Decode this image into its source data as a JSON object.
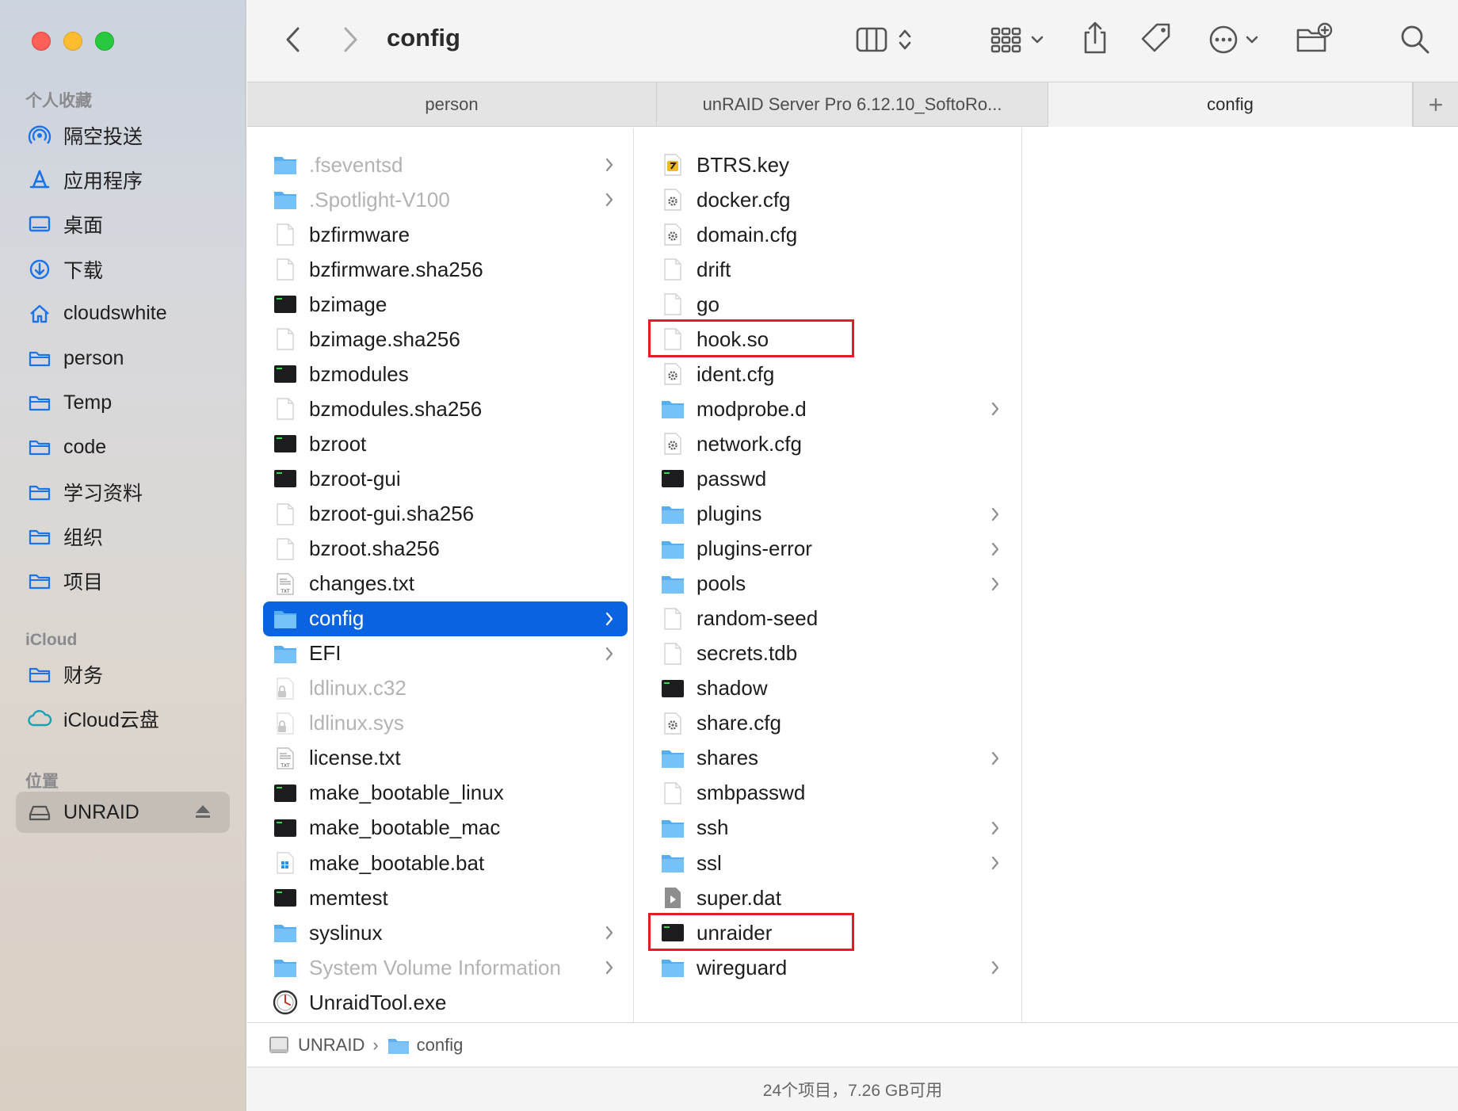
{
  "window": {
    "title": "config"
  },
  "sidebar": {
    "favorites_header": "个人收藏",
    "favorites": [
      {
        "label": "隔空投送",
        "icon": "airdrop-icon"
      },
      {
        "label": "应用程序",
        "icon": "applications-icon"
      },
      {
        "label": "桌面",
        "icon": "desktop-icon"
      },
      {
        "label": "下载",
        "icon": "downloads-icon"
      },
      {
        "label": "cloudswhite",
        "icon": "home-icon"
      },
      {
        "label": "person",
        "icon": "folder-icon"
      },
      {
        "label": "Temp",
        "icon": "folder-icon"
      },
      {
        "label": "code",
        "icon": "folder-icon"
      },
      {
        "label": "学习资料",
        "icon": "folder-icon"
      },
      {
        "label": "组织",
        "icon": "folder-icon"
      },
      {
        "label": "项目",
        "icon": "folder-icon"
      }
    ],
    "icloud_header": "iCloud",
    "icloud": [
      {
        "label": "财务",
        "icon": "folder-icon"
      },
      {
        "label": "iCloud云盘",
        "icon": "icloud-icon"
      }
    ],
    "locations_header": "位置",
    "locations": [
      {
        "label": "UNRAID",
        "icon": "drive-icon",
        "selected": true
      }
    ]
  },
  "tabs": [
    {
      "label": "person",
      "active": false
    },
    {
      "label": "unRAID Server Pro 6.12.10_SoftoRo...",
      "active": false
    },
    {
      "label": "config",
      "active": true
    }
  ],
  "column1": [
    {
      "name": ".fseventsd",
      "type": "folder",
      "dim": true,
      "chevron": true
    },
    {
      "name": ".Spotlight-V100",
      "type": "folder",
      "dim": true,
      "chevron": true
    },
    {
      "name": "bzfirmware",
      "type": "file"
    },
    {
      "name": "bzfirmware.sha256",
      "type": "file"
    },
    {
      "name": "bzimage",
      "type": "exec"
    },
    {
      "name": "bzimage.sha256",
      "type": "file"
    },
    {
      "name": "bzmodules",
      "type": "exec"
    },
    {
      "name": "bzmodules.sha256",
      "type": "file"
    },
    {
      "name": "bzroot",
      "type": "exec"
    },
    {
      "name": "bzroot-gui",
      "type": "exec"
    },
    {
      "name": "bzroot-gui.sha256",
      "type": "file"
    },
    {
      "name": "bzroot.sha256",
      "type": "file"
    },
    {
      "name": "changes.txt",
      "type": "txt"
    },
    {
      "name": "config",
      "type": "folder",
      "selected": true,
      "chevron": true
    },
    {
      "name": "EFI",
      "type": "folder",
      "chevron": true
    },
    {
      "name": "ldlinux.c32",
      "type": "locked",
      "dim": true
    },
    {
      "name": "ldlinux.sys",
      "type": "locked",
      "dim": true
    },
    {
      "name": "license.txt",
      "type": "txt"
    },
    {
      "name": "make_bootable_linux",
      "type": "exec"
    },
    {
      "name": "make_bootable_mac",
      "type": "exec"
    },
    {
      "name": "make_bootable.bat",
      "type": "bat"
    },
    {
      "name": "memtest",
      "type": "exec"
    },
    {
      "name": "syslinux",
      "type": "folder",
      "chevron": true
    },
    {
      "name": "System Volume Information",
      "type": "folder",
      "dim": true,
      "chevron": true
    },
    {
      "name": "UnraidTool.exe",
      "type": "exe"
    }
  ],
  "column2": [
    {
      "name": "BTRS.key",
      "type": "key"
    },
    {
      "name": "docker.cfg",
      "type": "cfg"
    },
    {
      "name": "domain.cfg",
      "type": "cfg"
    },
    {
      "name": "drift",
      "type": "file"
    },
    {
      "name": "go",
      "type": "file"
    },
    {
      "name": "hook.so",
      "type": "file",
      "highlight": true
    },
    {
      "name": "ident.cfg",
      "type": "cfg"
    },
    {
      "name": "modprobe.d",
      "type": "folder",
      "chevron": true
    },
    {
      "name": "network.cfg",
      "type": "cfg"
    },
    {
      "name": "passwd",
      "type": "exec"
    },
    {
      "name": "plugins",
      "type": "folder",
      "chevron": true
    },
    {
      "name": "plugins-error",
      "type": "folder",
      "chevron": true
    },
    {
      "name": "pools",
      "type": "folder",
      "chevron": true
    },
    {
      "name": "random-seed",
      "type": "file"
    },
    {
      "name": "secrets.tdb",
      "type": "file"
    },
    {
      "name": "shadow",
      "type": "exec"
    },
    {
      "name": "share.cfg",
      "type": "cfg"
    },
    {
      "name": "shares",
      "type": "folder",
      "chevron": true
    },
    {
      "name": "smbpasswd",
      "type": "file"
    },
    {
      "name": "ssh",
      "type": "folder",
      "chevron": true
    },
    {
      "name": "ssl",
      "type": "folder",
      "chevron": true
    },
    {
      "name": "super.dat",
      "type": "dat"
    },
    {
      "name": "unraider",
      "type": "exec",
      "highlight": true
    },
    {
      "name": "wireguard",
      "type": "folder",
      "chevron": true
    }
  ],
  "pathbar": {
    "drive": "UNRAID",
    "folder": "config",
    "separator": "›"
  },
  "status": {
    "text": "24个项目，7.26 GB可用"
  },
  "colors": {
    "accent": "#0a63e0",
    "highlight_box": "#e51c23",
    "folder": "#5ab0f0"
  }
}
